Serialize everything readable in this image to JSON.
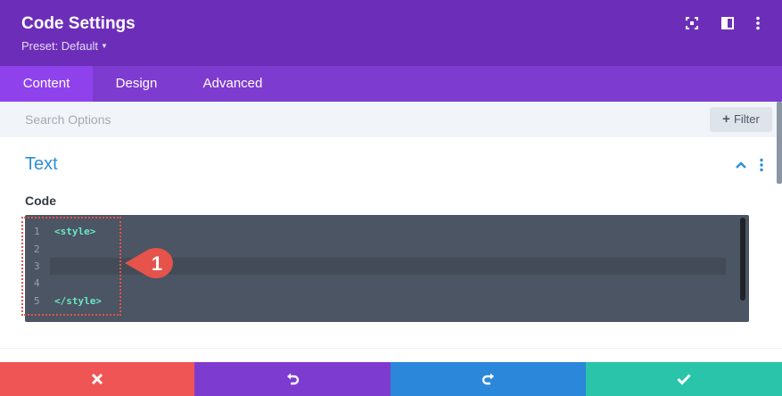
{
  "header": {
    "title": "Code Settings",
    "preset_label": "Preset: Default",
    "icons": [
      "expand-icon",
      "sidebar-split-icon",
      "kebab-menu-icon"
    ]
  },
  "tabs": [
    {
      "label": "Content",
      "active": true
    },
    {
      "label": "Design",
      "active": false
    },
    {
      "label": "Advanced",
      "active": false
    }
  ],
  "search": {
    "placeholder": "Search Options",
    "value": "",
    "filter_label": "Filter"
  },
  "section": {
    "title": "Text",
    "field_label": "Code"
  },
  "editor": {
    "line_numbers": [
      "1",
      "2",
      "3",
      "4",
      "5"
    ],
    "lines": [
      "<style>",
      "",
      "",
      "",
      "</style>"
    ],
    "active_line": 3
  },
  "callout": {
    "number": "1"
  },
  "actions": [
    {
      "name": "discard",
      "icon": "close-icon",
      "color": "#ef5555"
    },
    {
      "name": "undo",
      "icon": "undo-icon",
      "color": "#7e3bd0"
    },
    {
      "name": "redo",
      "icon": "redo-icon",
      "color": "#2b87da"
    },
    {
      "name": "save",
      "icon": "checkmark-icon",
      "color": "#29c4a9"
    }
  ],
  "colors": {
    "header": "#6c2eb9",
    "tabs": "#7e3bd0",
    "active_tab": "#8f42ec",
    "section_title": "#2e8fd6",
    "code_text": "#6be7c3",
    "callout": "#e5534b"
  }
}
